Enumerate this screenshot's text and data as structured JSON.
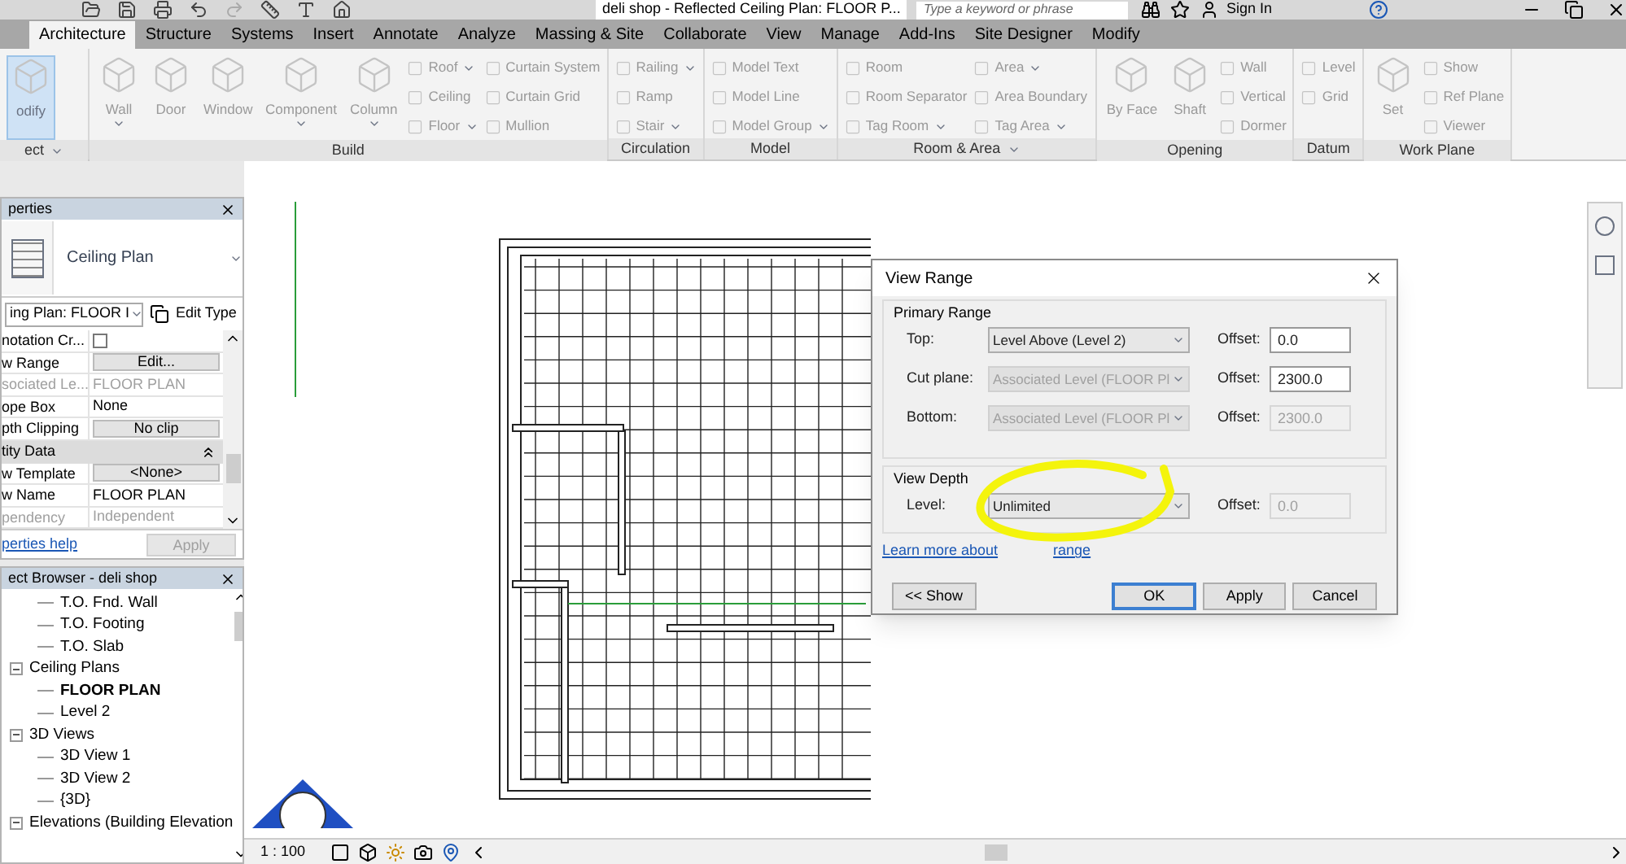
{
  "title_bar": {
    "title": "deli shop - Reflected Ceiling Plan: FLOOR P...",
    "search": {
      "placeholder": "Type a keyword or phrase"
    },
    "sign_in": "Sign In"
  },
  "tabs": [
    {
      "label": "Architecture",
      "selected": true
    },
    {
      "label": "Structure",
      "selected": false
    },
    {
      "label": "Systems",
      "selected": false
    },
    {
      "label": "Insert",
      "selected": false
    },
    {
      "label": "Annotate",
      "selected": false
    },
    {
      "label": "Analyze",
      "selected": false
    },
    {
      "label": "Massing & Site",
      "selected": false
    },
    {
      "label": "Collaborate",
      "selected": false
    },
    {
      "label": "View",
      "selected": false
    },
    {
      "label": "Manage",
      "selected": false
    },
    {
      "label": "Add-Ins",
      "selected": false
    },
    {
      "label": "Site Designer",
      "selected": false
    },
    {
      "label": "Modify",
      "selected": false
    }
  ],
  "ribbon": [
    {
      "label": "ect",
      "menu": true,
      "columns": [
        [
          {
            "kind": "large",
            "label": "odify",
            "dropdown": false,
            "active": true
          }
        ]
      ]
    },
    {
      "label": "Build",
      "menu": false,
      "columns": [
        [
          {
            "kind": "large",
            "label": "Wall",
            "dropdown": true,
            "active": false
          }
        ],
        [
          {
            "kind": "large",
            "label": "Door",
            "dropdown": false,
            "active": false
          }
        ],
        [
          {
            "kind": "large",
            "label": "Window",
            "dropdown": false,
            "active": false
          }
        ],
        [
          {
            "kind": "large",
            "label": "Component",
            "dropdown": true,
            "active": false
          }
        ],
        [
          {
            "kind": "large",
            "label": "Column",
            "dropdown": true,
            "active": false
          }
        ],
        [
          {
            "kind": "small",
            "label": "Roof",
            "dropdown": true
          },
          {
            "kind": "small",
            "label": "Ceiling",
            "dropdown": false
          },
          {
            "kind": "small",
            "label": "Floor",
            "dropdown": true
          }
        ],
        [
          {
            "kind": "small",
            "label": "Curtain System",
            "dropdown": false
          },
          {
            "kind": "small",
            "label": "Curtain Grid",
            "dropdown": false
          },
          {
            "kind": "small",
            "label": "Mullion",
            "dropdown": false
          }
        ]
      ]
    },
    {
      "label": "Circulation",
      "menu": false,
      "columns": [
        [
          {
            "kind": "small",
            "label": "Railing",
            "dropdown": true
          },
          {
            "kind": "small",
            "label": "Ramp",
            "dropdown": false
          },
          {
            "kind": "small",
            "label": "Stair",
            "dropdown": true
          }
        ]
      ]
    },
    {
      "label": "Model",
      "menu": false,
      "columns": [
        [
          {
            "kind": "small",
            "label": "Model Text",
            "dropdown": false
          },
          {
            "kind": "small",
            "label": "Model Line",
            "dropdown": false
          },
          {
            "kind": "small",
            "label": "Model Group",
            "dropdown": true
          }
        ]
      ]
    },
    {
      "label": "Room & Area",
      "menu": true,
      "columns": [
        [
          {
            "kind": "small",
            "label": "Room",
            "dropdown": false
          },
          {
            "kind": "small",
            "label": "Room Separator",
            "dropdown": false
          },
          {
            "kind": "small",
            "label": "Tag Room",
            "dropdown": true
          }
        ],
        [
          {
            "kind": "small",
            "label": "Area",
            "dropdown": true
          },
          {
            "kind": "small",
            "label": "Area Boundary",
            "dropdown": false
          },
          {
            "kind": "small",
            "label": "Tag Area",
            "dropdown": true
          }
        ]
      ]
    },
    {
      "label": "Opening",
      "menu": false,
      "columns": [
        [
          {
            "kind": "large",
            "label": "By Face",
            "dropdown": false,
            "active": false
          }
        ],
        [
          {
            "kind": "large",
            "label": "Shaft",
            "dropdown": false,
            "active": false
          }
        ],
        [
          {
            "kind": "small",
            "label": "Wall",
            "dropdown": false
          },
          {
            "kind": "small",
            "label": "Vertical",
            "dropdown": false
          },
          {
            "kind": "small",
            "label": "Dormer",
            "dropdown": false
          }
        ]
      ]
    },
    {
      "label": "Datum",
      "menu": false,
      "columns": [
        [
          {
            "kind": "small",
            "label": "Level",
            "dropdown": false
          },
          {
            "kind": "small",
            "label": "Grid",
            "dropdown": false
          }
        ]
      ]
    },
    {
      "label": "Work Plane",
      "menu": false,
      "columns": [
        [
          {
            "kind": "large",
            "label": "Set",
            "dropdown": false,
            "active": false
          }
        ],
        [
          {
            "kind": "small",
            "label": "Show",
            "dropdown": false
          },
          {
            "kind": "small",
            "label": "Ref Plane",
            "dropdown": false
          },
          {
            "kind": "small",
            "label": "Viewer",
            "dropdown": false
          }
        ]
      ]
    }
  ],
  "properties": {
    "title": "perties",
    "type_name": "Ceiling Plan",
    "instance_selector": "ing Plan: FLOOR I",
    "edit_type": "Edit Type",
    "rows": [
      {
        "kind": "checkbox",
        "name": "notation Cr...",
        "checked": false
      },
      {
        "kind": "button",
        "name": "w Range",
        "value": "Edit..."
      },
      {
        "kind": "text",
        "name": "sociated Le...",
        "value": "FLOOR PLAN",
        "disabled": true
      },
      {
        "kind": "text",
        "name": "ope Box",
        "value": "None",
        "disabled": false
      },
      {
        "kind": "button",
        "name": "pth Clipping",
        "value": "No clip"
      },
      {
        "kind": "group",
        "name": "tity Data"
      },
      {
        "kind": "button",
        "name": "w Template",
        "value": "<None>"
      },
      {
        "kind": "text",
        "name": "w Name",
        "value": "FLOOR PLAN",
        "disabled": false
      },
      {
        "kind": "text",
        "name": "pendency",
        "value": "Independent",
        "disabled": true
      }
    ],
    "help_link": "perties help",
    "apply": "Apply"
  },
  "project_browser": {
    "title": "ect Browser - deli shop",
    "tree": [
      {
        "children": [
          {
            "label": "T.O. Fnd. Wall",
            "current": false
          },
          {
            "label": "T.O. Footing",
            "current": false
          },
          {
            "label": "T.O. Slab",
            "current": false
          }
        ]
      },
      {
        "label": "Ceiling Plans",
        "expanded": true,
        "children": [
          {
            "label": "FLOOR PLAN",
            "current": true
          },
          {
            "label": "Level 2",
            "current": false
          }
        ]
      },
      {
        "label": "3D Views",
        "expanded": true,
        "children": [
          {
            "label": "3D View 1",
            "current": false
          },
          {
            "label": "3D View 2",
            "current": false
          },
          {
            "label": "{3D}",
            "current": false
          }
        ]
      },
      {
        "label": "Elevations (Building Elevation",
        "expanded": true
      }
    ]
  },
  "dialog": {
    "title": "View Range",
    "primary": {
      "title": "Primary Range",
      "rows": [
        {
          "label": "Top:",
          "select": {
            "value": "Level Above (Level 2)",
            "disabled": false
          },
          "offset_label": "Offset:",
          "offset": {
            "value": "0.0",
            "disabled": false
          }
        },
        {
          "label": "Cut plane:",
          "select": {
            "value": "Associated Level (FLOOR Pl",
            "disabled": true
          },
          "offset_label": "Offset:",
          "offset": {
            "value": "2300.0",
            "disabled": false
          }
        },
        {
          "label": "Bottom:",
          "select": {
            "value": "Associated Level (FLOOR Pl",
            "disabled": true
          },
          "offset_label": "Offset:",
          "offset": {
            "value": "2300.0",
            "disabled": true
          }
        }
      ]
    },
    "depth": {
      "title": "View Depth",
      "rows": [
        {
          "label": "Level:",
          "select": {
            "value": "Unlimited",
            "disabled": false
          },
          "offset_label": "Offset:",
          "offset": {
            "value": "0.0",
            "disabled": true
          }
        }
      ]
    },
    "link_before": "Learn more about",
    "link_after": "range",
    "buttons": [
      {
        "label": "<< Show",
        "default": false
      },
      {
        "label": "OK",
        "default": true
      },
      {
        "label": "Apply",
        "default": false
      },
      {
        "label": "Cancel",
        "default": false
      }
    ]
  },
  "status_bar": {
    "scale": "1 : 100"
  }
}
